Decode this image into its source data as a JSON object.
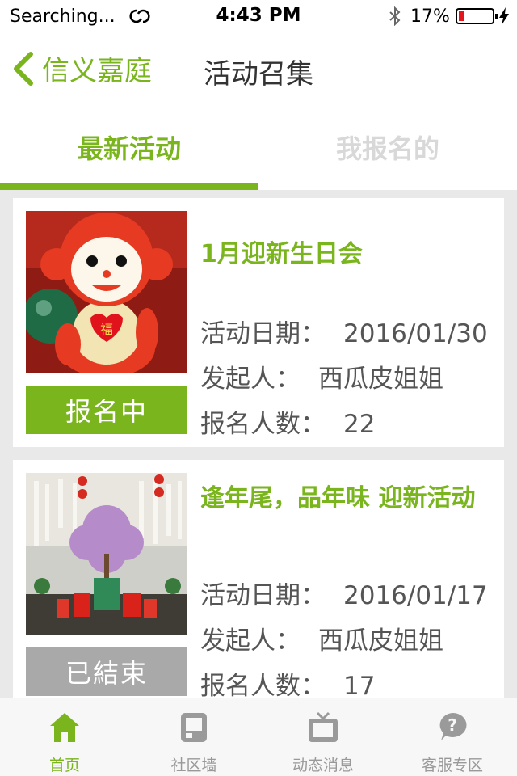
{
  "status_bar": {
    "carrier": "Searching...",
    "time": "4:43 PM",
    "battery_percent": "17%",
    "battery_level": 0.17,
    "icons": [
      "sync-icon",
      "bluetooth-icon",
      "battery-icon",
      "charging-bolt-icon"
    ]
  },
  "nav": {
    "back_label": "信义嘉庭",
    "title": "活动召集"
  },
  "tabs": [
    {
      "label": "最新活动",
      "active": true
    },
    {
      "label": "我报名的",
      "active": false
    }
  ],
  "events": [
    {
      "title": "1月迎新生日会",
      "date_label": "活动日期：",
      "date": "2016/01/30",
      "organizer_label": "发起人：",
      "organizer": "西瓜皮姐姐",
      "count_label": "报名人数：",
      "count": "22",
      "status": "报名中",
      "image": "red-monkey-plush-photo"
    },
    {
      "title": "逢年尾，品年味 迎新活动",
      "date_label": "活动日期：",
      "date": "2016/01/17",
      "organizer_label": "发起人：",
      "organizer": "西瓜皮姐姐",
      "count_label": "报名人数：",
      "count": "17",
      "status": "已結束",
      "image": "new-year-decoration-photo"
    }
  ],
  "tab_bar": [
    {
      "label": "首页",
      "icon": "home-icon",
      "active": true
    },
    {
      "label": "社区墙",
      "icon": "phone-icon",
      "active": false
    },
    {
      "label": "动态消息",
      "icon": "tv-icon",
      "active": false
    },
    {
      "label": "客服专区",
      "icon": "help-icon",
      "active": false
    }
  ],
  "colors": {
    "accent": "#7ab51d",
    "closed": "#a9a9a9",
    "battery_low": "#e3161e"
  }
}
